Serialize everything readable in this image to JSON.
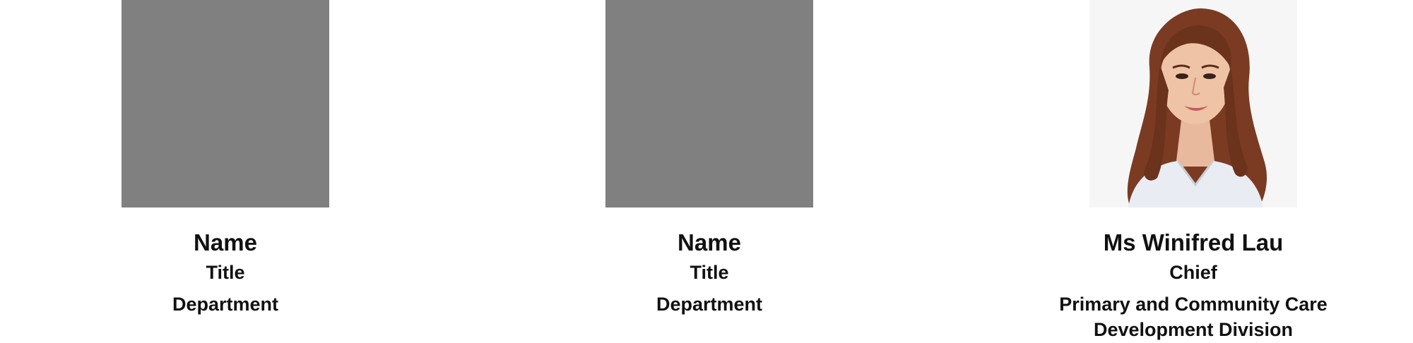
{
  "staff": [
    {
      "photo": "placeholder",
      "name": "Name",
      "title": "Title",
      "department_lines": [
        "Department"
      ]
    },
    {
      "photo": "placeholder",
      "name": "Name",
      "title": "Title",
      "department_lines": [
        "Department"
      ]
    },
    {
      "photo": "portrait",
      "name": "Ms Winifred Lau",
      "title": "Chief",
      "department_lines": [
        "Primary and Community Care",
        "Development Division"
      ]
    }
  ],
  "colors": {
    "placeholder_gray": "#808080",
    "text": "#111111",
    "background": "#ffffff"
  }
}
